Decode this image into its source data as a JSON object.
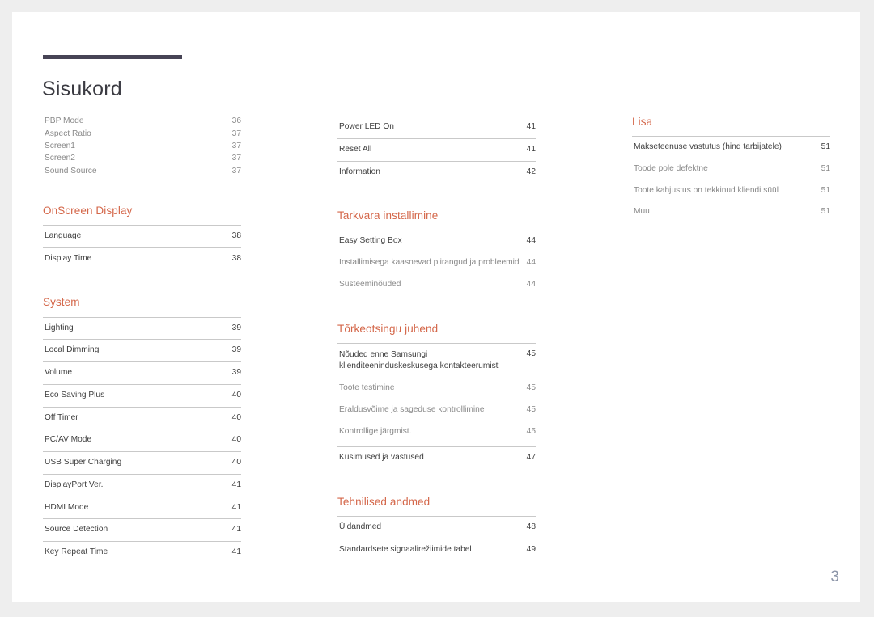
{
  "document": {
    "title": "Sisukord",
    "page_number": "3",
    "accent_color": "#d4674a",
    "rule_color": "#474455",
    "folio_color": "#8c95a8"
  },
  "columns": [
    {
      "name": "column-left",
      "blocks": [
        {
          "type": "list",
          "style": "compact",
          "entries": [
            {
              "label": "PBP Mode",
              "page": "36",
              "level": "sub"
            },
            {
              "label": "Aspect Ratio",
              "page": "37",
              "level": "sub"
            },
            {
              "label": "Screen1",
              "page": "37",
              "level": "sub"
            },
            {
              "label": "Screen2",
              "page": "37",
              "level": "sub"
            },
            {
              "label": "Sound Source",
              "page": "37",
              "level": "sub"
            }
          ]
        },
        {
          "type": "section",
          "heading": "OnScreen Display",
          "style": "ruled",
          "entries": [
            {
              "label": "Language",
              "page": "38",
              "level": "main"
            },
            {
              "label": "Display Time",
              "page": "38",
              "level": "main"
            }
          ]
        },
        {
          "type": "section",
          "heading": "System",
          "style": "ruled",
          "entries": [
            {
              "label": "Lighting",
              "page": "39",
              "level": "main"
            },
            {
              "label": "Local Dimming",
              "page": "39",
              "level": "main"
            },
            {
              "label": "Volume",
              "page": "39",
              "level": "main"
            },
            {
              "label": "Eco Saving Plus",
              "page": "40",
              "level": "main"
            },
            {
              "label": "Off Timer",
              "page": "40",
              "level": "main"
            },
            {
              "label": "PC/AV Mode",
              "page": "40",
              "level": "main"
            },
            {
              "label": "USB Super Charging",
              "page": "40",
              "level": "main"
            },
            {
              "label": "DisplayPort Ver.",
              "page": "41",
              "level": "main"
            },
            {
              "label": "HDMI Mode",
              "page": "41",
              "level": "main"
            },
            {
              "label": "Source Detection",
              "page": "41",
              "level": "main"
            },
            {
              "label": "Key Repeat Time",
              "page": "41",
              "level": "main"
            }
          ]
        }
      ]
    },
    {
      "name": "column-middle",
      "blocks": [
        {
          "type": "list",
          "style": "ruled",
          "entries": [
            {
              "label": "Power LED On",
              "page": "41",
              "level": "main"
            },
            {
              "label": "Reset All",
              "page": "41",
              "level": "main"
            },
            {
              "label": "Information",
              "page": "42",
              "level": "main"
            }
          ]
        },
        {
          "type": "section",
          "heading": "Tarkvara installimine",
          "style": "group",
          "entries": [
            {
              "label": "Easy Setting Box",
              "page": "44",
              "level": "main"
            },
            {
              "label": "Installimisega kaasnevad piirangud ja probleemid",
              "page": "44",
              "level": "sub"
            },
            {
              "label": "Süsteeminõuded",
              "page": "44",
              "level": "sub"
            }
          ]
        },
        {
          "type": "section",
          "heading": "Tõrkeotsingu juhend",
          "style": "group-multi",
          "entries": [
            {
              "label": "Nõuded enne Samsungi klienditeeninduskeskusega kontakteerumist",
              "page": "45",
              "level": "main",
              "wrap": true
            },
            {
              "label": "Toote testimine",
              "page": "45",
              "level": "sub"
            },
            {
              "label": "Eraldusvõime ja sageduse kontrollimine",
              "page": "45",
              "level": "sub"
            },
            {
              "label": "Kontrollige järgmist.",
              "page": "45",
              "level": "sub"
            },
            {
              "label": "Küsimused ja vastused",
              "page": "47",
              "level": "main",
              "ruled": true
            }
          ]
        },
        {
          "type": "section",
          "heading": "Tehnilised andmed",
          "style": "ruled",
          "entries": [
            {
              "label": "Üldandmed",
              "page": "48",
              "level": "main"
            },
            {
              "label": "Standardsete signaalirežiimide tabel",
              "page": "49",
              "level": "main"
            }
          ]
        }
      ]
    },
    {
      "name": "column-right",
      "blocks": [
        {
          "type": "section",
          "heading": "Lisa",
          "style": "group",
          "entries": [
            {
              "label": "Makseteenuse vastutus (hind tarbijatele)",
              "page": "51",
              "level": "main"
            },
            {
              "label": "Toode pole defektne",
              "page": "51",
              "level": "sub"
            },
            {
              "label": "Toote kahjustus on tekkinud kliendi süül",
              "page": "51",
              "level": "sub"
            },
            {
              "label": "Muu",
              "page": "51",
              "level": "sub"
            }
          ]
        }
      ]
    }
  ]
}
